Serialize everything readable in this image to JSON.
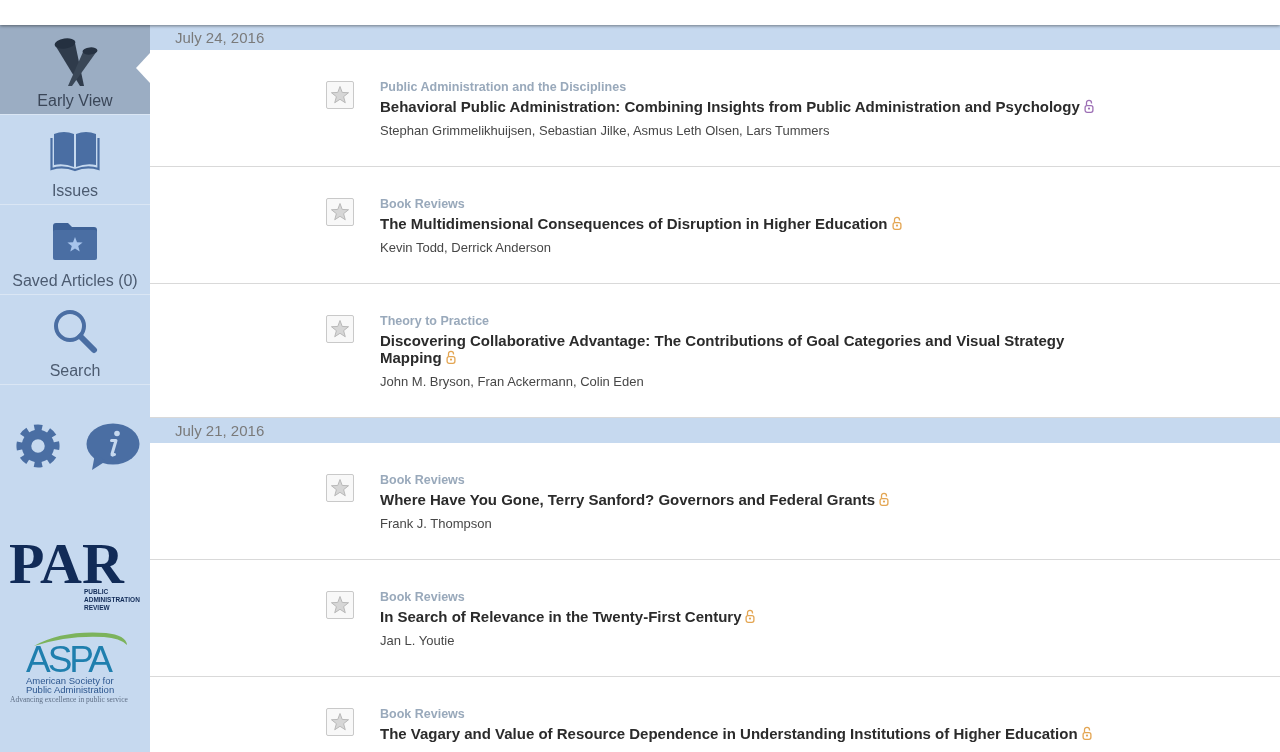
{
  "sidebar": {
    "nav": [
      {
        "kind": "early",
        "label": "Early View",
        "selected": true
      },
      {
        "kind": "issues",
        "label": "Issues",
        "selected": false
      },
      {
        "kind": "saved",
        "label": "Saved Articles (0)",
        "selected": false
      },
      {
        "kind": "search",
        "label": "Search",
        "selected": false
      }
    ],
    "par_logo": {
      "wordmark": "PAR",
      "subtitle": "PUBLIC ADMINISTRATION REVIEW"
    },
    "aspa_logo": {
      "wordmark": "ASPA",
      "name": "American Society for Public Administration",
      "tagline": "Advancing excellence in public service"
    }
  },
  "feed": [
    {
      "date": "July 24, 2016",
      "articles": [
        {
          "section": "Public Administration and the Disciplines",
          "title": "Behavioral Public Administration: Combining Insights from Public Administration and Psychology",
          "authors": "Stephan Grimmelikhuijsen, Sebastian Jilke, Asmus Leth Olsen, Lars Tummers",
          "saved": false,
          "color": "#9d6fb5"
        },
        {
          "section": "Book Reviews",
          "title": "The Multidimensional Consequences of Disruption in Higher Education",
          "authors": "Kevin Todd, Derrick Anderson",
          "saved": false,
          "color": "#e3a552"
        },
        {
          "section": "Theory to Practice",
          "title": "Discovering Collaborative Advantage: The Contributions of Goal Categories and Visual Strategy Mapping",
          "authors": "John M. Bryson, Fran Ackermann, Colin Eden",
          "saved": false,
          "color": "#e3a552"
        }
      ]
    },
    {
      "date": "July 21, 2016",
      "articles": [
        {
          "section": "Book Reviews",
          "title": "Where Have You Gone, Terry Sanford? Governors and Federal Grants",
          "authors": "Frank J. Thompson",
          "saved": false,
          "color": "#e3a552"
        },
        {
          "section": "Book Reviews",
          "title": "In Search of Relevance in the Twenty-First Century",
          "authors": "Jan L. Youtie",
          "saved": false,
          "color": "#e3a552"
        },
        {
          "section": "Book Reviews",
          "title": "The Vagary and Value of Resource Dependence in Understanding Institutions of Higher Education",
          "saved": false,
          "color": "#e3a552"
        }
      ]
    }
  ]
}
